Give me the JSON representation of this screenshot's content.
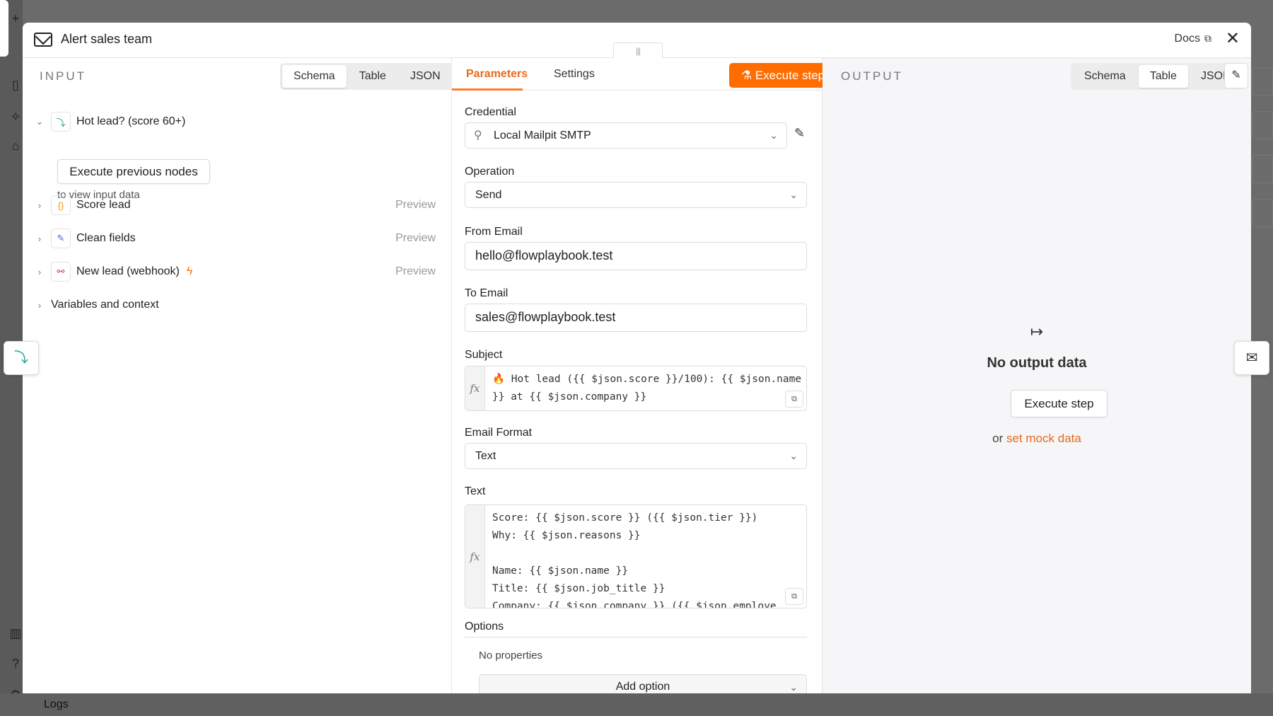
{
  "modal": {
    "title": "Alert sales team",
    "docs_label": "Docs",
    "close_label": "✕"
  },
  "input": {
    "title": "INPUT",
    "view_tabs": [
      "Schema",
      "Table",
      "JSON"
    ],
    "selected_view": "Schema",
    "tree": [
      {
        "label": "Hot lead? (score 60+)",
        "icon": "branch-icon",
        "expanded": true
      },
      {
        "label": "Score lead",
        "icon": "code-icon",
        "preview": "Preview"
      },
      {
        "label": "Clean fields",
        "icon": "edit-icon",
        "preview": "Preview"
      },
      {
        "label": "New lead (webhook)",
        "icon": "webhook-icon",
        "preview": "Preview",
        "badge": "lightning-icon"
      },
      {
        "label": "Variables and context"
      }
    ],
    "execute_previous_label": "Execute previous nodes",
    "hint": "to view input data"
  },
  "params": {
    "tabs": [
      "Parameters",
      "Settings"
    ],
    "active_tab": "Parameters",
    "execute_label": "Execute step",
    "credential": {
      "label": "Credential",
      "value": "Local Mailpit SMTP"
    },
    "operation": {
      "label": "Operation",
      "value": "Send"
    },
    "from_email": {
      "label": "From Email",
      "value": "hello@flowplaybook.test"
    },
    "to_email": {
      "label": "To Email",
      "value": "sales@flowplaybook.test"
    },
    "subject": {
      "label": "Subject",
      "value": "🔥 Hot lead ({{ $json.score }}/100): {{ $json.name }} at {{ $json.company }}"
    },
    "email_format": {
      "label": "Email Format",
      "value": "Text"
    },
    "text": {
      "label": "Text",
      "value": "Score: {{ $json.score }} ({{ $json.tier }})\nWhy: {{ $json.reasons }}\n\nName: {{ $json.name }}\nTitle: {{ $json.job_title }}\nCompany: {{ $json.company }} ({{ $json.employe"
    },
    "options": {
      "label": "Options",
      "empty": "No properties",
      "add_label": "Add option"
    }
  },
  "output": {
    "title": "OUTPUT",
    "view_tabs": [
      "Schema",
      "Table",
      "JSON"
    ],
    "selected_view": "Table",
    "empty_title": "No output data",
    "execute_label": "Execute step",
    "or_text": "or",
    "mock_link": "set mock data"
  },
  "background": {
    "logs_label": "Logs"
  },
  "colors": {
    "accent": "#ff6d00",
    "link": "#e86a1c"
  }
}
